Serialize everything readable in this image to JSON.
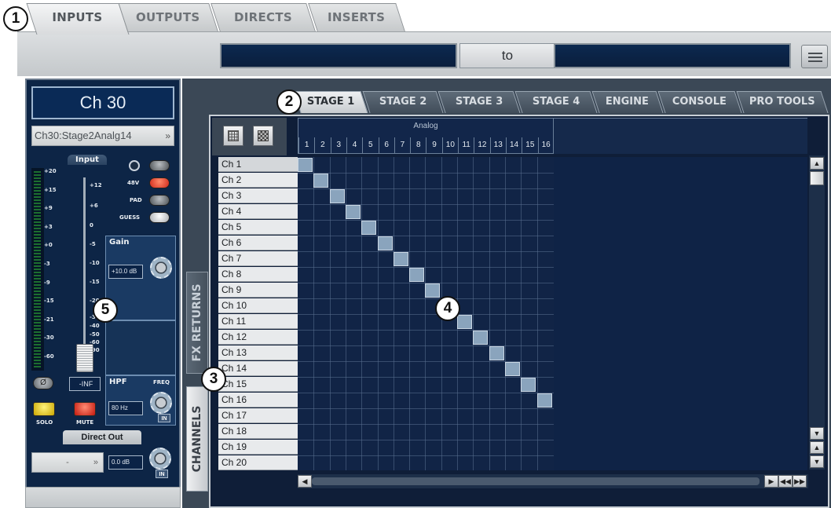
{
  "top_tabs": [
    {
      "label": "INPUTS",
      "active": true
    },
    {
      "label": "OUTPUTS",
      "active": false
    },
    {
      "label": "DIRECTS",
      "active": false
    },
    {
      "label": "INSERTS",
      "active": false
    }
  ],
  "route_bar": {
    "source_value": "",
    "to_label": "to",
    "dest_value": ""
  },
  "channel_strip": {
    "name": "Ch 30",
    "source": "Ch30:Stage2Analg14",
    "input_title": "Input",
    "meter_scale": [
      "+20",
      "+15",
      "+9",
      "+3",
      "+0",
      "-3",
      "-9",
      "-15",
      "-21",
      "-30",
      "-60"
    ],
    "fader_scale": [
      "+12",
      "+6",
      "0",
      "-5",
      "-10",
      "-15",
      "-20",
      "-30",
      "-40",
      "-50",
      "-60",
      "-90"
    ],
    "switches": {
      "phantom": "48V",
      "pad": "PAD",
      "guess": "GUESS"
    },
    "gain": {
      "title": "Gain",
      "value": "+10.0 dB"
    },
    "fader_value": "-INF",
    "hpf": {
      "title": "HPF",
      "freq_label": "FREQ",
      "value": "80 Hz",
      "in_label": "IN"
    },
    "solo_label": "SOLO",
    "mute_label": "MUTE",
    "direct_out": {
      "title": "Direct Out",
      "assignment": "-",
      "value": "0.0 dB",
      "in_label": "IN"
    }
  },
  "stage_tabs": [
    {
      "label": "STAGE 1",
      "active": true
    },
    {
      "label": "STAGE 2",
      "active": false
    },
    {
      "label": "STAGE 3",
      "active": false
    },
    {
      "label": "STAGE 4",
      "active": false
    },
    {
      "label": "ENGINE",
      "active": false
    },
    {
      "label": "CONSOLE",
      "active": false
    },
    {
      "label": "PRO TOOLS",
      "active": false
    }
  ],
  "side_tabs": {
    "fx_returns": "FX RETURNS",
    "channels": "CHANNELS"
  },
  "grid": {
    "column_group": "Analog",
    "columns": [
      "1",
      "2",
      "3",
      "4",
      "5",
      "6",
      "7",
      "8",
      "9",
      "10",
      "11",
      "12",
      "13",
      "14",
      "15",
      "16"
    ],
    "rows": [
      "Ch 1",
      "Ch 2",
      "Ch 3",
      "Ch 4",
      "Ch 5",
      "Ch 6",
      "Ch 7",
      "Ch 8",
      "Ch 9",
      "Ch 10",
      "Ch 11",
      "Ch 12",
      "Ch 13",
      "Ch 14",
      "Ch 15",
      "Ch 16",
      "Ch 17",
      "Ch 18",
      "Ch 19",
      "Ch 20"
    ],
    "assignments": [
      [
        0,
        0
      ],
      [
        1,
        1
      ],
      [
        2,
        2
      ],
      [
        3,
        3
      ],
      [
        4,
        4
      ],
      [
        5,
        5
      ],
      [
        6,
        6
      ],
      [
        7,
        7
      ],
      [
        8,
        8
      ],
      [
        9,
        9
      ],
      [
        10,
        10
      ],
      [
        11,
        11
      ],
      [
        12,
        12
      ],
      [
        13,
        13
      ],
      [
        14,
        14
      ],
      [
        15,
        15
      ]
    ]
  },
  "callouts": [
    "1",
    "2",
    "3",
    "4",
    "5"
  ],
  "icons": {
    "grid_view": "grid-icon",
    "patchbay_view": "checker-icon",
    "menu": "list-icon",
    "phase": "phase-icon"
  }
}
